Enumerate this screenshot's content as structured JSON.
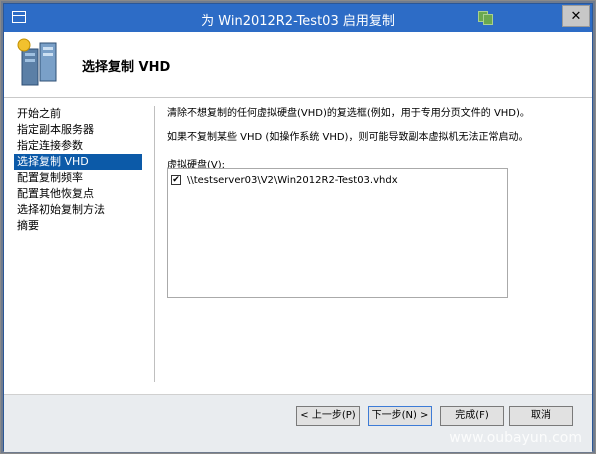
{
  "window": {
    "title": "为 Win2012R2-Test03 启用复制",
    "close_label": "✕"
  },
  "header": {
    "title": "选择复制 VHD"
  },
  "nav": {
    "items": [
      {
        "label": "开始之前",
        "active": false
      },
      {
        "label": "指定副本服务器",
        "active": false
      },
      {
        "label": "指定连接参数",
        "active": false
      },
      {
        "label": "选择复制 VHD",
        "active": true
      },
      {
        "label": "配置复制频率",
        "active": false
      },
      {
        "label": "配置其他恢复点",
        "active": false
      },
      {
        "label": "选择初始复制方法",
        "active": false
      },
      {
        "label": "摘要",
        "active": false
      }
    ]
  },
  "main": {
    "description_1": "清除不想复制的任何虚拟硬盘(VHD)的复选框(例如，用于专用分页文件的 VHD)。",
    "description_2": "如果不复制某些 VHD (如操作系统 VHD)，则可能导致副本虚拟机无法正常启动。",
    "list_label": "虚拟硬盘(V):",
    "vhds": [
      {
        "checked": true,
        "check_mark": "✔",
        "path": "\\\\testserver03\\V2\\Win2012R2-Test03.vhdx"
      }
    ]
  },
  "buttons": {
    "prev": "< 上一步(P)",
    "next": "下一步(N) >",
    "finish": "完成(F)",
    "cancel": "取消"
  },
  "watermark": "www.oubayun.com",
  "colors": {
    "titlebar": "#2d6cc6",
    "nav_active": "#0c5aa8"
  }
}
